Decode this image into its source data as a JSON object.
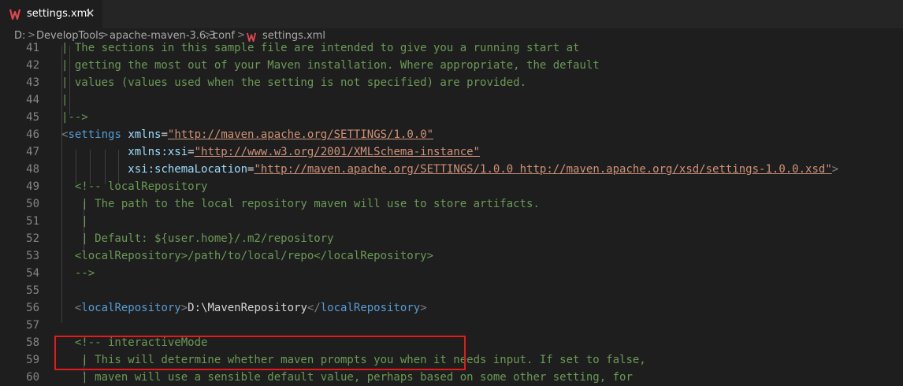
{
  "tab": {
    "label": "settings.xml",
    "close": "✕"
  },
  "breadcrumb": {
    "items": [
      "D:",
      "DevelopTools",
      "apache-maven-3.6.3",
      "conf",
      "settings.xml"
    ],
    "separator": ">"
  },
  "colors": {
    "comment": "#6a9955",
    "tag": "#569cd6",
    "attribute": "#9cdcfe",
    "string": "#ce9178",
    "text": "#d4d4d4",
    "highlight_border": "#e51a1a"
  },
  "editor": {
    "lines": [
      {
        "n": "41",
        "parts": [
          [
            "c-comment",
            "| The sections in this sample file are intended to give you a running start at"
          ]
        ]
      },
      {
        "n": "42",
        "parts": [
          [
            "c-comment",
            "| getting the most out of your Maven installation. Where appropriate, the default"
          ]
        ]
      },
      {
        "n": "43",
        "parts": [
          [
            "c-comment",
            "| values (values used when the setting is not specified) are provided."
          ]
        ]
      },
      {
        "n": "44",
        "parts": [
          [
            "c-comment",
            "|"
          ]
        ]
      },
      {
        "n": "45",
        "parts": [
          [
            "c-comment",
            "|-->"
          ]
        ]
      },
      {
        "n": "46",
        "parts": [
          [
            "c-punct",
            "<"
          ],
          [
            "c-tag",
            "settings"
          ],
          [
            "c-text",
            " "
          ],
          [
            "c-attr",
            "xmlns"
          ],
          [
            "c-text",
            "="
          ],
          [
            "c-str",
            "\"http://maven.apache.org/SETTINGS/1.0.0\""
          ]
        ]
      },
      {
        "n": "47",
        "parts": [
          [
            "c-text",
            "          "
          ],
          [
            "c-attr",
            "xmlns:xsi"
          ],
          [
            "c-text",
            "="
          ],
          [
            "c-str",
            "\"http://www.w3.org/2001/XMLSchema-instance\""
          ]
        ]
      },
      {
        "n": "48",
        "parts": [
          [
            "c-text",
            "          "
          ],
          [
            "c-attr",
            "xsi:schemaLocation"
          ],
          [
            "c-text",
            "="
          ],
          [
            "c-str",
            "\"http://maven.apache.org/SETTINGS/1.0.0 http://maven.apache.org/xsd/settings-1.0.0.xsd\""
          ],
          [
            "c-punct",
            ">"
          ]
        ]
      },
      {
        "n": "49",
        "parts": [
          [
            "c-comment",
            "  <!-- localRepository"
          ]
        ]
      },
      {
        "n": "50",
        "parts": [
          [
            "c-comment",
            "   | The path to the local repository maven will use to store artifacts."
          ]
        ]
      },
      {
        "n": "51",
        "parts": [
          [
            "c-comment",
            "   |"
          ]
        ]
      },
      {
        "n": "52",
        "parts": [
          [
            "c-comment",
            "   | Default: ${user.home}/.m2/repository"
          ]
        ]
      },
      {
        "n": "53",
        "parts": [
          [
            "c-comment",
            "  <localRepository>/path/to/local/repo</localRepository>"
          ]
        ]
      },
      {
        "n": "54",
        "parts": [
          [
            "c-comment",
            "  -->"
          ]
        ]
      },
      {
        "n": "55",
        "parts": []
      },
      {
        "n": "56",
        "parts": [
          [
            "c-text",
            "  "
          ],
          [
            "c-punct",
            "<"
          ],
          [
            "c-tag",
            "localRepository"
          ],
          [
            "c-punct",
            ">"
          ],
          [
            "c-text",
            "D:\\MavenRepository"
          ],
          [
            "c-punct",
            "</"
          ],
          [
            "c-tag",
            "localRepository"
          ],
          [
            "c-punct",
            ">"
          ]
        ]
      },
      {
        "n": "57",
        "parts": []
      },
      {
        "n": "58",
        "parts": [
          [
            "c-comment",
            "  <!-- interactiveMode"
          ]
        ]
      },
      {
        "n": "59",
        "parts": [
          [
            "c-comment",
            "   | This will determine whether maven prompts you when it needs input. If set to false,"
          ]
        ]
      },
      {
        "n": "60",
        "parts": [
          [
            "c-comment",
            "   | maven will use a sensible default value, perhaps based on some other setting, for"
          ]
        ]
      }
    ]
  }
}
